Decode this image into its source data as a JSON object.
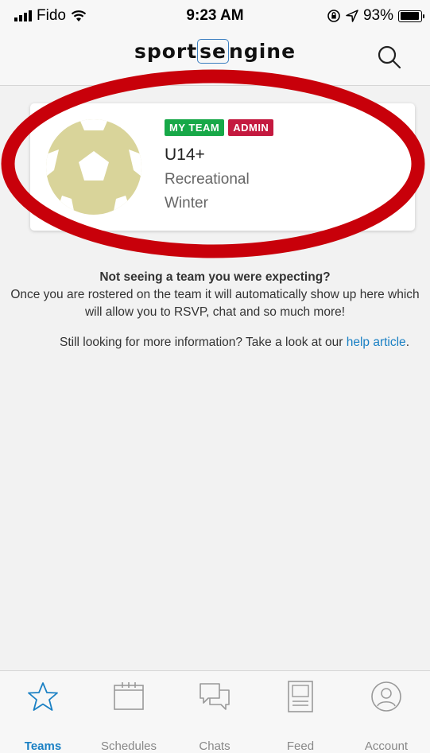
{
  "status_bar": {
    "carrier": "Fido",
    "time": "9:23 AM",
    "battery": "93%",
    "battery_level": 0.93
  },
  "header": {
    "logo_left": "sport",
    "logo_mid": "se",
    "logo_right": "ngine",
    "search_icon": "search-icon"
  },
  "team_card": {
    "badge_my_team": "MY TEAM",
    "badge_admin": "ADMIN",
    "team_name": "U14+",
    "line1": "Recreational",
    "line2": "Winter",
    "avatar_icon": "soccer-ball-icon"
  },
  "info": {
    "title": "Not seeing a team you were expecting?",
    "body": "Once you are rostered on the team it will automatically show up here which will allow you to RSVP, chat and so much more!",
    "help_prefix": "Still looking for more information? Take a look at our",
    "help_link": "help article",
    "help_suffix": "."
  },
  "tabs": [
    {
      "label": "Teams",
      "icon": "star-icon",
      "active": true
    },
    {
      "label": "Schedules",
      "icon": "calendar-icon",
      "active": false
    },
    {
      "label": "Chats",
      "icon": "chat-icon",
      "active": false
    },
    {
      "label": "Feed",
      "icon": "feed-icon",
      "active": false
    },
    {
      "label": "Account",
      "icon": "account-icon",
      "active": false
    }
  ],
  "colors": {
    "accent": "#1a80c4",
    "my_team_badge": "#17a848",
    "admin_badge": "#c4193f",
    "annotation": "#c8000a"
  }
}
